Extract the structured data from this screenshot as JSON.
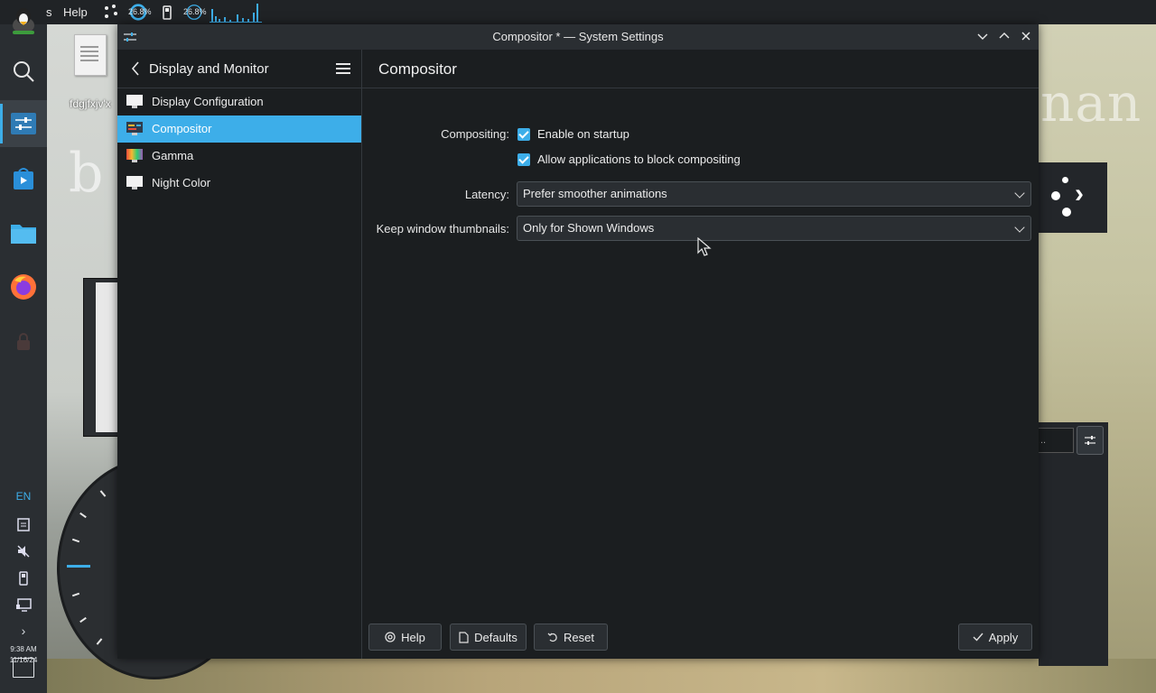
{
  "top_panel": {
    "menu_partial": "s",
    "menu_help": "Help",
    "cpu_percent": "26.8%",
    "mem_percent": "26.8%"
  },
  "desktop": {
    "file_name": "fdgjfxjv'x",
    "wallpaper_text": "nan",
    "wallpaper_text_left": "b"
  },
  "dock": {
    "language": "EN",
    "time": "9:38 AM",
    "date": "11/16/24",
    "accent_color": "#3daee9"
  },
  "window": {
    "title": "Compositor * — System Settings"
  },
  "sidebar": {
    "title": "Display and Monitor",
    "items": [
      {
        "label": "Display Configuration",
        "icon": "monitor-icon"
      },
      {
        "label": "Compositor",
        "icon": "compositor-icon"
      },
      {
        "label": "Gamma",
        "icon": "gamma-icon"
      },
      {
        "label": "Night Color",
        "icon": "night-color-icon"
      }
    ],
    "selected_index": 1
  },
  "content": {
    "title": "Compositor",
    "compositing_label": "Compositing:",
    "enable_on_startup": {
      "label": "Enable on startup",
      "checked": true
    },
    "allow_block": {
      "label": "Allow applications to block compositing",
      "checked": true
    },
    "latency_label": "Latency:",
    "latency_value": "Prefer smoother animations",
    "thumbnails_label": "Keep window thumbnails:",
    "thumbnails_value": "Only for Shown Windows"
  },
  "footer": {
    "help_label": "Help",
    "defaults_label": "Defaults",
    "reset_label": "Reset",
    "apply_label": "Apply"
  }
}
